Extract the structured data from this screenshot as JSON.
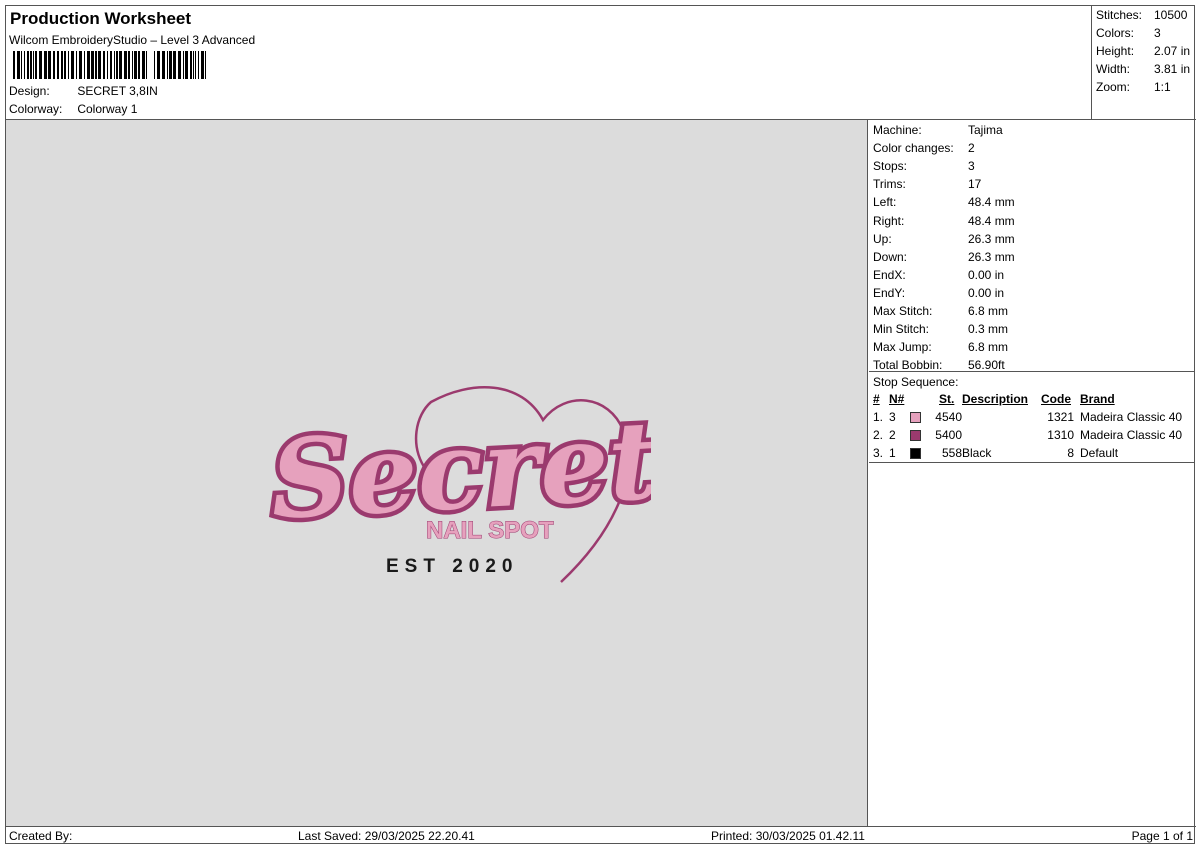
{
  "header": {
    "title": "Production Worksheet",
    "subtitle": "Wilcom EmbroideryStudio – Level 3 Advanced",
    "design_label": "Design:",
    "design_value": "SECRET 3,8IN",
    "colorway_label": "Colorway:",
    "colorway_value": "Colorway 1"
  },
  "summary": [
    {
      "label": "Stitches:",
      "value": "10500"
    },
    {
      "label": "Colors:",
      "value": "3"
    },
    {
      "label": "Height:",
      "value": "2.07 in"
    },
    {
      "label": "Width:",
      "value": "3.81 in"
    },
    {
      "label": "Zoom:",
      "value": "1:1"
    }
  ],
  "machine": [
    {
      "label": "Machine:",
      "value": "Tajima"
    },
    {
      "label": "Color changes:",
      "value": "2"
    },
    {
      "label": "Stops:",
      "value": "3"
    },
    {
      "label": "Trims:",
      "value": "17"
    },
    {
      "label": "Left:",
      "value": "48.4 mm"
    },
    {
      "label": "Right:",
      "value": "48.4 mm"
    },
    {
      "label": "Up:",
      "value": "26.3 mm"
    },
    {
      "label": "Down:",
      "value": "26.3 mm"
    },
    {
      "label": "EndX:",
      "value": "0.00 in"
    },
    {
      "label": "EndY:",
      "value": "0.00 in"
    },
    {
      "label": "Max Stitch:",
      "value": "6.8 mm"
    },
    {
      "label": "Min Stitch:",
      "value": "0.3 mm"
    },
    {
      "label": "Max Jump:",
      "value": "6.8 mm"
    },
    {
      "label": "Total Bobbin:",
      "value": "56.90ft"
    }
  ],
  "stop_sequence": {
    "title": "Stop Sequence:",
    "headers": {
      "num": "#",
      "n": "N#",
      "st": "St.",
      "description": "Description",
      "code": "Code",
      "brand": "Brand"
    },
    "rows": [
      {
        "num": "1.",
        "n": "3",
        "color": "#e6a1bd",
        "st": "4540",
        "description": "",
        "code": "1321",
        "brand": "Madeira Classic 40"
      },
      {
        "num": "2.",
        "n": "2",
        "color": "#9b3a6e",
        "st": "5400",
        "description": "",
        "code": "1310",
        "brand": "Madeira Classic 40"
      },
      {
        "num": "3.",
        "n": "1",
        "color": "#000000",
        "st": "558",
        "description": "Black",
        "code": "8",
        "brand": "Default"
      }
    ]
  },
  "design": {
    "script_text": "Secret",
    "subtext": "NAIL SPOT",
    "est_text": "EST 2020",
    "fill_color": "#e6a1bd",
    "outline_color": "#9b3a6e",
    "black_color": "#1a1a1a"
  },
  "footer": {
    "created_by": "Created By:",
    "last_saved": "Last Saved: 29/03/2025 22.20.41",
    "printed": "Printed: 30/03/2025 01.42.11",
    "page": "Page 1 of 1"
  }
}
